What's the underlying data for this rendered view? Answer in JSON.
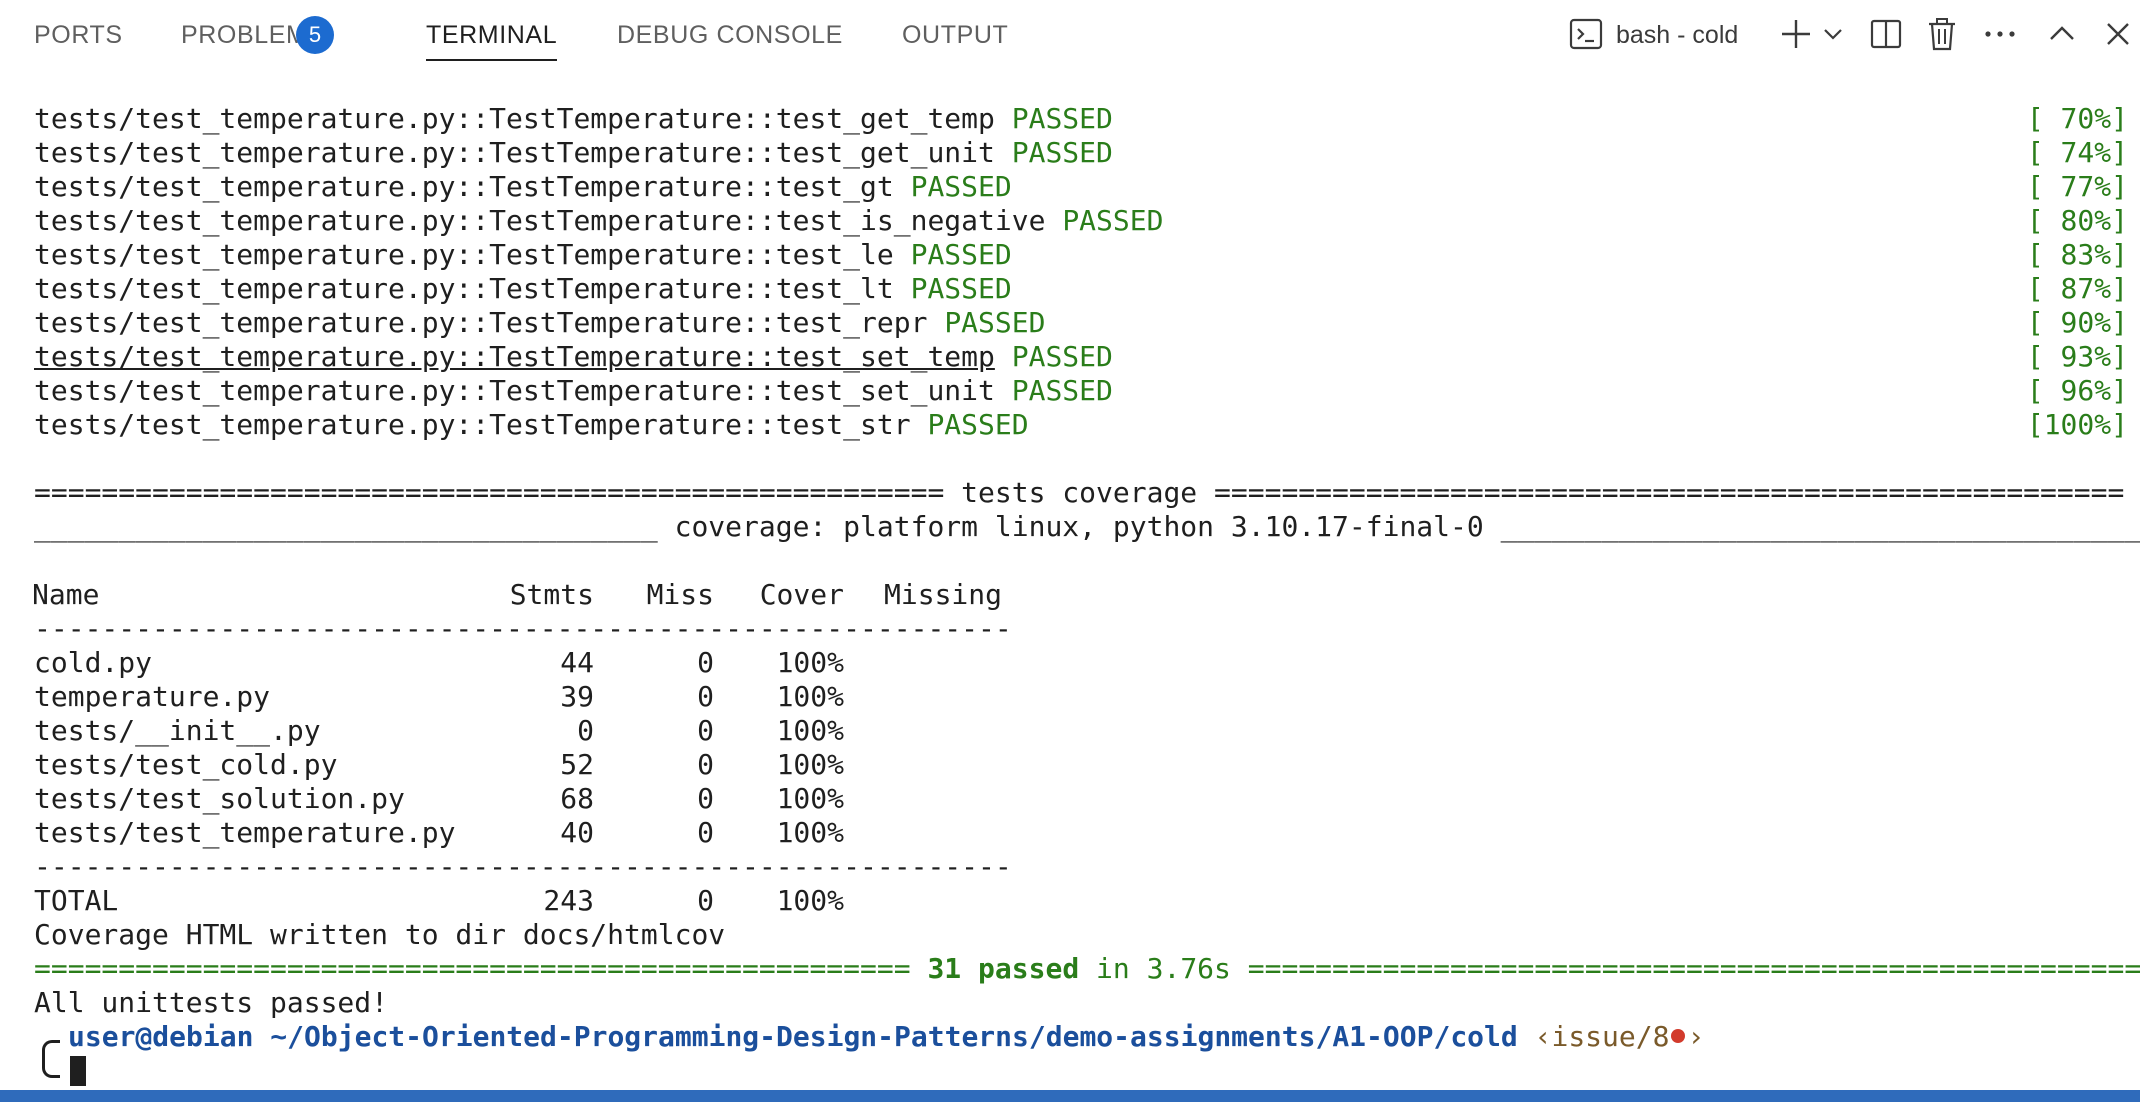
{
  "panel": {
    "tabs": [
      {
        "label": "PORTS"
      },
      {
        "label": "PROBLEMS"
      },
      {
        "label": "TERMINAL"
      },
      {
        "label": "DEBUG CONSOLE"
      },
      {
        "label": "OUTPUT"
      }
    ],
    "problems_count": "5",
    "active_tab": "TERMINAL",
    "terminal_name": "bash - cold",
    "toolbar_icons": [
      "terminal-icon",
      "plus-icon",
      "chevron-down-icon",
      "split-editor-icon",
      "trash-icon",
      "more-icon",
      "chevron-up-icon",
      "close-icon"
    ]
  },
  "terminal": {
    "test_lines": [
      {
        "name": "tests/test_temperature.py::TestTemperature::test_get_temp",
        "status": "PASSED",
        "percent": "[ 70%]"
      },
      {
        "name": "tests/test_temperature.py::TestTemperature::test_get_unit",
        "status": "PASSED",
        "percent": "[ 74%]"
      },
      {
        "name": "tests/test_temperature.py::TestTemperature::test_gt",
        "status": "PASSED",
        "percent": "[ 77%]"
      },
      {
        "name": "tests/test_temperature.py::TestTemperature::test_is_negative",
        "status": "PASSED",
        "percent": "[ 80%]"
      },
      {
        "name": "tests/test_temperature.py::TestTemperature::test_le",
        "status": "PASSED",
        "percent": "[ 83%]"
      },
      {
        "name": "tests/test_temperature.py::TestTemperature::test_lt",
        "status": "PASSED",
        "percent": "[ 87%]"
      },
      {
        "name": "tests/test_temperature.py::TestTemperature::test_repr",
        "status": "PASSED",
        "percent": "[ 90%]"
      },
      {
        "name": "tests/test_temperature.py::TestTemperature::test_set_temp",
        "status": "PASSED",
        "percent": "[ 93%]"
      },
      {
        "name": "tests/test_temperature.py::TestTemperature::test_set_unit",
        "status": "PASSED",
        "percent": "[ 96%]"
      },
      {
        "name": "tests/test_temperature.py::TestTemperature::test_str",
        "status": "PASSED",
        "percent": "[100%]"
      }
    ],
    "coverage_header": "====================================================== tests coverage ======================================================",
    "coverage_subheader": "_____________________________________ coverage: platform linux, python 3.10.17-final-0 ______________________________________",
    "table": {
      "headers": [
        "Name",
        "Stmts",
        "Miss",
        "Cover",
        "Missing"
      ],
      "separator": "----------------------------------------------------------",
      "rows": [
        {
          "name": "cold.py",
          "stmts": "44",
          "miss": "0",
          "cover": "100%"
        },
        {
          "name": "temperature.py",
          "stmts": "39",
          "miss": "0",
          "cover": "100%"
        },
        {
          "name": "tests/__init__.py",
          "stmts": "0",
          "miss": "0",
          "cover": "100%"
        },
        {
          "name": "tests/test_cold.py",
          "stmts": "52",
          "miss": "0",
          "cover": "100%"
        },
        {
          "name": "tests/test_solution.py",
          "stmts": "68",
          "miss": "0",
          "cover": "100%"
        },
        {
          "name": "tests/test_temperature.py",
          "stmts": "40",
          "miss": "0",
          "cover": "100%"
        }
      ],
      "total": {
        "name": "TOTAL",
        "stmts": "243",
        "miss": "0",
        "cover": "100%"
      }
    },
    "html_written": "Coverage HTML written to dir docs/htmlcov",
    "summary": {
      "left_rule": "====================================================",
      "passed": "31 passed",
      "time": " in 3.76s ",
      "right_rule": "============================================================"
    },
    "all_passed": "All unittests passed!",
    "prompt": {
      "user": "user@debian",
      "path": "~/Object-Oriented-Programming-Design-Patterns/demo-assignments/A1-OOP/cold",
      "branch_open": "‹issue/8",
      "branch_close": "›",
      "symbol": "$"
    }
  }
}
